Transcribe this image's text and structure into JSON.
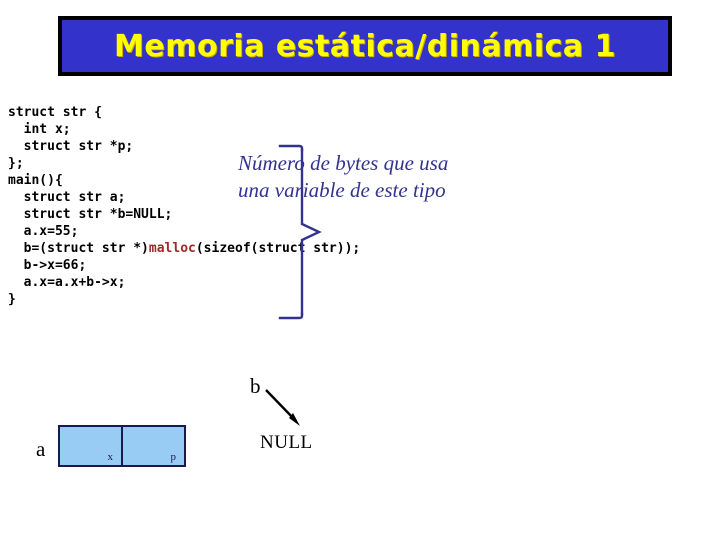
{
  "title": {
    "text": "Memoria estática/dinámica 1",
    "background_color": "#3333cc",
    "text_color": "#ffff00",
    "border_color": "#000000"
  },
  "code": {
    "language": "c",
    "highlight_color": "#a02828",
    "highlighted_token": "malloc",
    "lines": [
      "struct str {",
      "  int x;",
      "  struct str *p;",
      "};",
      "main(){",
      "  struct str a;",
      "  struct str *b=NULL;",
      "  a.x=55;",
      "  b=(struct str *)malloc(sizeof(struct str));",
      "  b->x=66;",
      "  a.x=a.x+b->x;",
      "}"
    ],
    "line_parts": [
      [
        {
          "t": "struct str {",
          "c": "plain"
        }
      ],
      [
        {
          "t": "  int x;",
          "c": "plain"
        }
      ],
      [
        {
          "t": "  struct str *p;",
          "c": "plain"
        }
      ],
      [
        {
          "t": "};",
          "c": "plain"
        }
      ],
      [
        {
          "t": "main(){",
          "c": "plain"
        }
      ],
      [
        {
          "t": "  struct str a;",
          "c": "plain"
        }
      ],
      [
        {
          "t": "  struct str *b=NULL;",
          "c": "plain"
        }
      ],
      [
        {
          "t": "  a.x=55;",
          "c": "plain"
        }
      ],
      [
        {
          "t": "  b=(struct str *)",
          "c": "plain"
        },
        {
          "t": "malloc",
          "c": "kw-malloc"
        },
        {
          "t": "(sizeof(struct str));",
          "c": "plain"
        }
      ],
      [
        {
          "t": "  b->x=66;",
          "c": "plain"
        }
      ],
      [
        {
          "t": "  a.x=a.x+b->x;",
          "c": "plain"
        }
      ],
      [
        {
          "t": "}",
          "c": "plain"
        }
      ]
    ]
  },
  "annotation": {
    "color": "#33338f",
    "line1": "Número de bytes que usa",
    "line2": "una variable de este tipo"
  },
  "diagram": {
    "box_fill": "#99ccf5",
    "box_border": "#1a1a4d",
    "variable_a_label": "a",
    "cells": [
      {
        "label": "x"
      },
      {
        "label": "p"
      }
    ],
    "variable_b_label": "b",
    "null_label": "NULL"
  }
}
